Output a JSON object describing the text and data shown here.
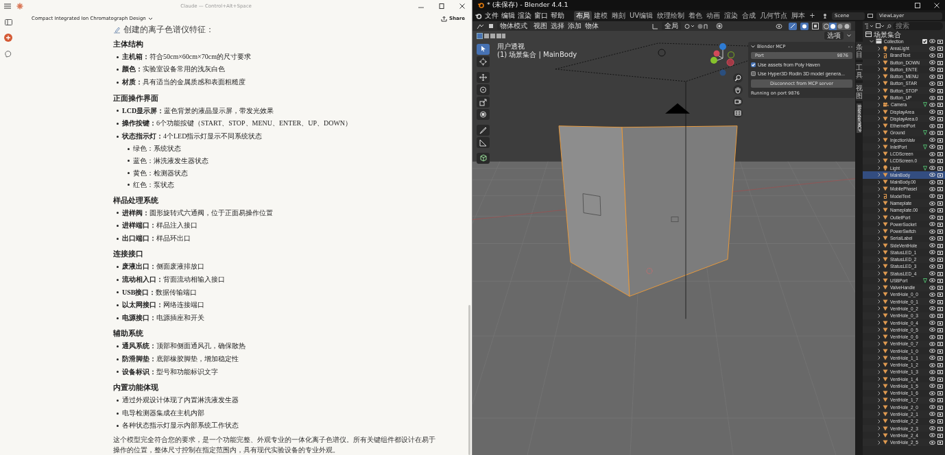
{
  "claude_window": {
    "title": "Claude — Control+Alt+Space",
    "conversation_title": "Compact Integrated Ion Chromatograph Design",
    "share": "Share",
    "intro": "创建的离子色谱仪特征：",
    "sections": [
      {
        "heading": "主体结构",
        "items": [
          {
            "label": "主机箱：",
            "text": "符合50cm×60cm×70cm的尺寸要求"
          },
          {
            "label": "颜色：",
            "text": "实验室设备常用的浅灰白色"
          },
          {
            "label": "材质：",
            "text": "具有适当的金属质感和表面粗糙度"
          }
        ]
      },
      {
        "heading": "正面操作界面",
        "items": [
          {
            "label": "LCD显示屏：",
            "text": "蓝色背景的液晶显示屏，带发光效果"
          },
          {
            "label": "操作按键：",
            "text": "6个功能按键（START、STOP、MENU、ENTER、UP、DOWN）"
          },
          {
            "label": "状态指示灯：",
            "text": "4个LED指示灯显示不同系统状态",
            "children": [
              {
                "text": "绿色：系统状态"
              },
              {
                "text": "蓝色：淋洗液发生器状态"
              },
              {
                "text": "黄色：检测器状态"
              },
              {
                "text": "红色：泵状态"
              }
            ]
          }
        ]
      },
      {
        "heading": "样品处理系统",
        "items": [
          {
            "label": "进样阀：",
            "text": "圆形旋转式六通阀，位于正面易操作位置"
          },
          {
            "label": "进样端口：",
            "text": "样品注入接口"
          },
          {
            "label": "出口端口：",
            "text": "样品环出口"
          }
        ]
      },
      {
        "heading": "连接接口",
        "items": [
          {
            "label": "废液出口：",
            "text": "侧面废液排放口"
          },
          {
            "label": "流动相入口：",
            "text": "背面流动相输入接口"
          },
          {
            "label": "USB接口：",
            "text": "数据传输端口"
          },
          {
            "label": "以太网接口：",
            "text": "网络连接端口"
          },
          {
            "label": "电源接口：",
            "text": "电源插座和开关"
          }
        ]
      },
      {
        "heading": "辅助系统",
        "items": [
          {
            "label": "通风系统：",
            "text": "顶部和侧面通风孔，确保散热"
          },
          {
            "label": "防滑脚垫：",
            "text": "底部橡胶脚垫，增加稳定性"
          },
          {
            "label": "设备标识：",
            "text": "型号和功能标识文字"
          }
        ]
      },
      {
        "heading": "内置功能体现",
        "items": [
          {
            "text": "通过外观设计体现了内置淋洗液发生器"
          },
          {
            "text": "电导检测器集成在主机内部"
          },
          {
            "text": "各种状态指示灯显示内部系统工作状态"
          }
        ]
      }
    ],
    "conclusion": "这个模型完全符合您的要求，是一个功能完整、外观专业的一体化离子色谱仪。所有关键组件都设计在易于操作的位置，整体尺寸控制在指定范围内，具有现代实验设备的专业外观。"
  },
  "blender": {
    "title": "* (未保存) - Blender 4.4.1",
    "menus": [
      "文件",
      "编辑",
      "渲染",
      "窗口",
      "帮助"
    ],
    "workspaces": [
      {
        "label": "布局",
        "selected": true
      },
      {
        "label": "建模",
        "selected": false
      },
      {
        "label": "雕刻",
        "selected": false
      },
      {
        "label": "UV编辑",
        "selected": false
      },
      {
        "label": "纹理绘制",
        "selected": false
      },
      {
        "label": "着色",
        "selected": false
      },
      {
        "label": "动画",
        "selected": false
      },
      {
        "label": "渲染",
        "selected": false
      },
      {
        "label": "合成",
        "selected": false
      },
      {
        "label": "几何节点",
        "selected": false
      },
      {
        "label": "脚本",
        "selected": false
      }
    ],
    "add_workspace": "+",
    "scene": "Scene",
    "view_layer": "ViewLayer",
    "mode": "物体模式",
    "header_menus": [
      "视图",
      "选择",
      "添加",
      "物体"
    ],
    "orientation": "全局",
    "options": "选项",
    "viewport_info": [
      "用户透视",
      "(1) 场景集合 | MainBody"
    ],
    "mcp_panel": {
      "title": "Blender MCP",
      "port_label": "Port",
      "port_value": "9876",
      "options": [
        {
          "label": "Use assets from Poly Haven",
          "checked": true
        },
        {
          "label": "Use Hyper3D Rodin 3D model genera...",
          "checked": false
        }
      ],
      "button": "Disconnect from MCP server",
      "status": "Running on port 9876"
    },
    "sidebar_tabs": [
      {
        "label": "条目",
        "selected": false
      },
      {
        "label": "工具",
        "selected": false
      },
      {
        "label": "视图",
        "selected": false
      },
      {
        "label": "BlenderMCP",
        "selected": true
      }
    ],
    "outliner": {
      "search_placeholder": "搜索",
      "root": "场景集合",
      "collection": {
        "name": "Collection",
        "checked": true
      },
      "objects": [
        {
          "name": "AreaLight",
          "kind": "light",
          "selected": false,
          "data_badge": false
        },
        {
          "name": "BrandText",
          "kind": "text",
          "selected": false,
          "data_badge": false
        },
        {
          "name": "Button_DOWN",
          "kind": "mesh",
          "selected": false,
          "data_badge": false
        },
        {
          "name": "Button_ENTE",
          "kind": "mesh",
          "selected": false,
          "data_badge": false
        },
        {
          "name": "Button_MENU",
          "kind": "mesh",
          "selected": false,
          "data_badge": false
        },
        {
          "name": "Button_STAR",
          "kind": "mesh",
          "selected": false,
          "data_badge": false
        },
        {
          "name": "Button_STOP",
          "kind": "mesh",
          "selected": false,
          "data_badge": false
        },
        {
          "name": "Button_UP",
          "kind": "mesh",
          "selected": false,
          "data_badge": false
        },
        {
          "name": "Camera",
          "kind": "camera",
          "selected": false,
          "data_badge": true
        },
        {
          "name": "DisplayArea",
          "kind": "mesh",
          "selected": false,
          "data_badge": false
        },
        {
          "name": "DisplayArea.0",
          "kind": "mesh",
          "selected": false,
          "data_badge": false
        },
        {
          "name": "EthernetPort",
          "kind": "mesh",
          "selected": false,
          "data_badge": false
        },
        {
          "name": "Ground",
          "kind": "mesh",
          "selected": false,
          "data_badge": true
        },
        {
          "name": "InjectionValv",
          "kind": "mesh",
          "selected": false,
          "data_badge": false
        },
        {
          "name": "InletPort",
          "kind": "mesh",
          "selected": false,
          "data_badge": true
        },
        {
          "name": "LCDScreen",
          "kind": "mesh",
          "selected": false,
          "data_badge": false
        },
        {
          "name": "LCDScreen.0",
          "kind": "mesh",
          "selected": false,
          "data_badge": false
        },
        {
          "name": "Light",
          "kind": "light",
          "selected": false,
          "data_badge": true
        },
        {
          "name": "MainBody",
          "kind": "mesh",
          "selected": true,
          "data_badge": false
        },
        {
          "name": "MainBody.00",
          "kind": "mesh",
          "selected": false,
          "data_badge": false
        },
        {
          "name": "MobilePhaseI",
          "kind": "mesh",
          "selected": false,
          "data_badge": false
        },
        {
          "name": "ModelText",
          "kind": "text",
          "selected": false,
          "data_badge": false
        },
        {
          "name": "Nameplate",
          "kind": "mesh",
          "selected": false,
          "data_badge": false
        },
        {
          "name": "Nameplate.00",
          "kind": "mesh",
          "selected": false,
          "data_badge": false
        },
        {
          "name": "OutletPort",
          "kind": "mesh",
          "selected": false,
          "data_badge": false
        },
        {
          "name": "PowerSocket",
          "kind": "mesh",
          "selected": false,
          "data_badge": false
        },
        {
          "name": "PowerSwitch",
          "kind": "mesh",
          "selected": false,
          "data_badge": false
        },
        {
          "name": "SerialLabel",
          "kind": "mesh",
          "selected": false,
          "data_badge": false
        },
        {
          "name": "SideVentHole",
          "kind": "mesh",
          "selected": false,
          "data_badge": false
        },
        {
          "name": "StatusLED_1",
          "kind": "mesh",
          "selected": false,
          "data_badge": false
        },
        {
          "name": "StatusLED_2",
          "kind": "mesh",
          "selected": false,
          "data_badge": false
        },
        {
          "name": "StatusLED_3",
          "kind": "mesh",
          "selected": false,
          "data_badge": false
        },
        {
          "name": "StatusLED_4",
          "kind": "mesh",
          "selected": false,
          "data_badge": false
        },
        {
          "name": "USBPort",
          "kind": "mesh",
          "selected": false,
          "data_badge": true
        },
        {
          "name": "ValveHandle",
          "kind": "mesh",
          "selected": false,
          "data_badge": false
        },
        {
          "name": "VentHole_0_0",
          "kind": "mesh",
          "selected": false,
          "data_badge": false
        },
        {
          "name": "VentHole_0_1",
          "kind": "mesh",
          "selected": false,
          "data_badge": false
        },
        {
          "name": "VentHole_0_2",
          "kind": "mesh",
          "selected": false,
          "data_badge": false
        },
        {
          "name": "VentHole_0_3",
          "kind": "mesh",
          "selected": false,
          "data_badge": false
        },
        {
          "name": "VentHole_0_4",
          "kind": "mesh",
          "selected": false,
          "data_badge": false
        },
        {
          "name": "VentHole_0_5",
          "kind": "mesh",
          "selected": false,
          "data_badge": false
        },
        {
          "name": "VentHole_0_6",
          "kind": "mesh",
          "selected": false,
          "data_badge": false
        },
        {
          "name": "VentHole_0_7",
          "kind": "mesh",
          "selected": false,
          "data_badge": false
        },
        {
          "name": "VentHole_1_0",
          "kind": "mesh",
          "selected": false,
          "data_badge": false
        },
        {
          "name": "VentHole_1_1",
          "kind": "mesh",
          "selected": false,
          "data_badge": false
        },
        {
          "name": "VentHole_1_2",
          "kind": "mesh",
          "selected": false,
          "data_badge": false
        },
        {
          "name": "VentHole_1_3",
          "kind": "mesh",
          "selected": false,
          "data_badge": false
        },
        {
          "name": "VentHole_1_4",
          "kind": "mesh",
          "selected": false,
          "data_badge": false
        },
        {
          "name": "VentHole_1_5",
          "kind": "mesh",
          "selected": false,
          "data_badge": false
        },
        {
          "name": "VentHole_1_6",
          "kind": "mesh",
          "selected": false,
          "data_badge": false
        },
        {
          "name": "VentHole_1_7",
          "kind": "mesh",
          "selected": false,
          "data_badge": false
        },
        {
          "name": "VentHole_2_0",
          "kind": "mesh",
          "selected": false,
          "data_badge": false
        },
        {
          "name": "VentHole_2_1",
          "kind": "mesh",
          "selected": false,
          "data_badge": false
        },
        {
          "name": "VentHole_2_2",
          "kind": "mesh",
          "selected": false,
          "data_badge": false
        },
        {
          "name": "VentHole_2_3",
          "kind": "mesh",
          "selected": false,
          "data_badge": false
        },
        {
          "name": "VentHole_2_4",
          "kind": "mesh",
          "selected": false,
          "data_badge": false
        },
        {
          "name": "VentHole_2_5",
          "kind": "mesh",
          "selected": false,
          "data_badge": false
        }
      ]
    }
  }
}
